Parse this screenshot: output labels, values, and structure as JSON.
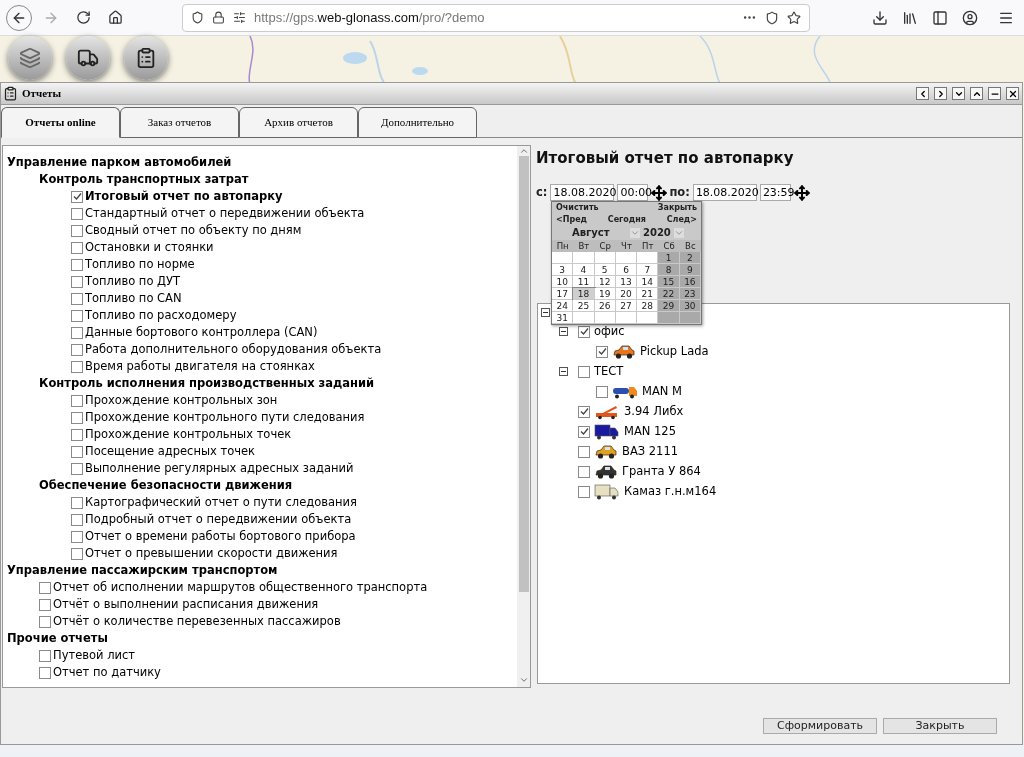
{
  "browser": {
    "back_disabled": false,
    "forward_disabled": true,
    "url_parts": [
      "https://gps.",
      "web-glonass.com",
      "/pro/?demo"
    ]
  },
  "window": {
    "title": "Отчеты",
    "tabs": [
      {
        "label": "Отчеты online",
        "selected": true
      },
      {
        "label": "Заказ отчетов",
        "selected": false
      },
      {
        "label": "Архив отчетов",
        "selected": false
      },
      {
        "label": "Дополнительно",
        "selected": false
      }
    ]
  },
  "reports": [
    {
      "label": "Управление парком автомобилей",
      "children": [
        {
          "label": "Контроль транспортных затрат",
          "children": [
            {
              "label": "Итоговый отчет по автопарку",
              "checked": true,
              "selected": true
            },
            {
              "label": "Стандартный отчет о передвижении объекта",
              "checked": false,
              "selected": false
            },
            {
              "label": "Сводный отчет по объекту по дням",
              "checked": false,
              "selected": false
            },
            {
              "label": "Остановки и стоянки",
              "checked": false,
              "selected": false
            },
            {
              "label": "Топливо по норме",
              "checked": false,
              "selected": false
            },
            {
              "label": "Топливо по ДУТ",
              "checked": false,
              "selected": false
            },
            {
              "label": "Топливо по CAN",
              "checked": false,
              "selected": false
            },
            {
              "label": "Топливо по расходомеру",
              "checked": false,
              "selected": false
            },
            {
              "label": "Данные бортового контроллера (CAN)",
              "checked": false,
              "selected": false
            },
            {
              "label": "Работа дополнительного оборудования объекта",
              "checked": false,
              "selected": false
            },
            {
              "label": "Время работы двигателя на стоянках",
              "checked": false,
              "selected": false
            }
          ]
        },
        {
          "label": "Контроль исполнения производственных заданий",
          "children": [
            {
              "label": "Прохождение контрольных зон",
              "checked": false,
              "selected": false
            },
            {
              "label": "Прохождение контрольного пути следования",
              "checked": false,
              "selected": false
            },
            {
              "label": "Прохождение контрольных точек",
              "checked": false,
              "selected": false
            },
            {
              "label": "Посещение адресных точек",
              "checked": false,
              "selected": false
            },
            {
              "label": "Выполнение регулярных адресных заданий",
              "checked": false,
              "selected": false
            }
          ]
        },
        {
          "label": "Обеспечение безопасности движения",
          "children": [
            {
              "label": "Картографический отчет о пути следования",
              "checked": false,
              "selected": false
            },
            {
              "label": "Подробный отчет о передвижении объекта",
              "checked": false,
              "selected": false
            },
            {
              "label": "Отчет о времени работы бортового прибора",
              "checked": false,
              "selected": false
            },
            {
              "label": "Отчет о превышении скорости движения",
              "checked": false,
              "selected": false
            }
          ]
        }
      ]
    },
    {
      "label": "Управление пассажирским транспортом",
      "children": [
        {
          "label": "Отчет об исполнении маршрутов общественного транспорта",
          "checked": false,
          "selected": false
        },
        {
          "label": "Отчёт о выполнении расписания движения",
          "checked": false,
          "selected": false
        },
        {
          "label": "Отчёт о количестве перевезенных пассажиров",
          "checked": false,
          "selected": false
        }
      ]
    },
    {
      "label": "Прочие отчеты",
      "children": [
        {
          "label": "Путевой лист",
          "checked": false,
          "selected": false
        },
        {
          "label": "Отчет по датчику",
          "checked": false,
          "selected": false
        }
      ]
    }
  ],
  "report": {
    "title": "Итоговый отчет по автопарку",
    "from": {
      "label": "с:",
      "date": "18.08.2020",
      "time": "00:00"
    },
    "to": {
      "label": "по:",
      "date": "18.08.2020",
      "time": "23:59"
    }
  },
  "calendar": {
    "clear": "Очистить",
    "close": "Закрыть",
    "prev": "<Пред",
    "today": "Сегодня",
    "next": "След>",
    "month": "Август",
    "year": "2020",
    "weekdays": [
      "Пн",
      "Вт",
      "Ср",
      "Чт",
      "Пт",
      "Сб",
      "Вс"
    ],
    "weeks": [
      [
        {
          "day": "1",
          "selected": false
        },
        {
          "day": "2",
          "selected": false
        }
      ],
      [
        {
          "day": "3",
          "selected": false
        },
        {
          "day": "4",
          "selected": false
        },
        {
          "day": "5",
          "selected": false
        },
        {
          "day": "6",
          "selected": false
        },
        {
          "day": "7",
          "selected": false
        },
        {
          "day": "8",
          "selected": false
        },
        {
          "day": "9",
          "selected": false
        }
      ],
      [
        {
          "day": "10",
          "selected": false
        },
        {
          "day": "11",
          "selected": false
        },
        {
          "day": "12",
          "selected": false
        },
        {
          "day": "13",
          "selected": false
        },
        {
          "day": "14",
          "selected": false
        },
        {
          "day": "15",
          "selected": false
        },
        {
          "day": "16",
          "selected": false
        }
      ],
      [
        {
          "day": "17",
          "selected": false
        },
        {
          "day": "18",
          "selected": true
        },
        {
          "day": "19",
          "selected": false
        },
        {
          "day": "20",
          "selected": false
        },
        {
          "day": "21",
          "selected": false
        },
        {
          "day": "22",
          "selected": false
        },
        {
          "day": "23",
          "selected": false
        }
      ],
      [
        {
          "day": "24",
          "selected": false
        },
        {
          "day": "25",
          "selected": false
        },
        {
          "day": "26",
          "selected": false
        },
        {
          "day": "27",
          "selected": false
        },
        {
          "day": "28",
          "selected": false
        },
        {
          "day": "29",
          "selected": false
        },
        {
          "day": "30",
          "selected": false
        }
      ],
      [
        {
          "day": "31",
          "selected": false
        }
      ]
    ]
  },
  "vehicles": {
    "expanded": true,
    "children": [
      {
        "label": "офис",
        "checked": true,
        "expanded": true,
        "children": [
          {
            "label": "Pickup Lada",
            "checked": true,
            "kind": "car",
            "color": "#e8741e"
          }
        ]
      },
      {
        "label": "ТЕСТ",
        "checked": false,
        "expanded": true,
        "children": [
          {
            "label": "MAN M",
            "checked": false,
            "kind": "tanker",
            "color": "#f08a1c"
          }
        ]
      },
      {
        "label": "3.94 Либх",
        "checked": true,
        "kind": "crane",
        "color": "#e0561c"
      },
      {
        "label": "MAN 125",
        "checked": true,
        "kind": "truck",
        "color": "#1a1aa0"
      },
      {
        "label": "ВАЗ 2111",
        "checked": false,
        "kind": "car",
        "color": "#e0a020"
      },
      {
        "label": "Гранта У 864",
        "checked": false,
        "kind": "car",
        "color": "#333333"
      },
      {
        "label": "Камаз г.н.м164",
        "checked": false,
        "kind": "truck",
        "color": "#e6dfc0"
      }
    ]
  },
  "buttons": [
    "Сформировать",
    "Закрыть"
  ]
}
